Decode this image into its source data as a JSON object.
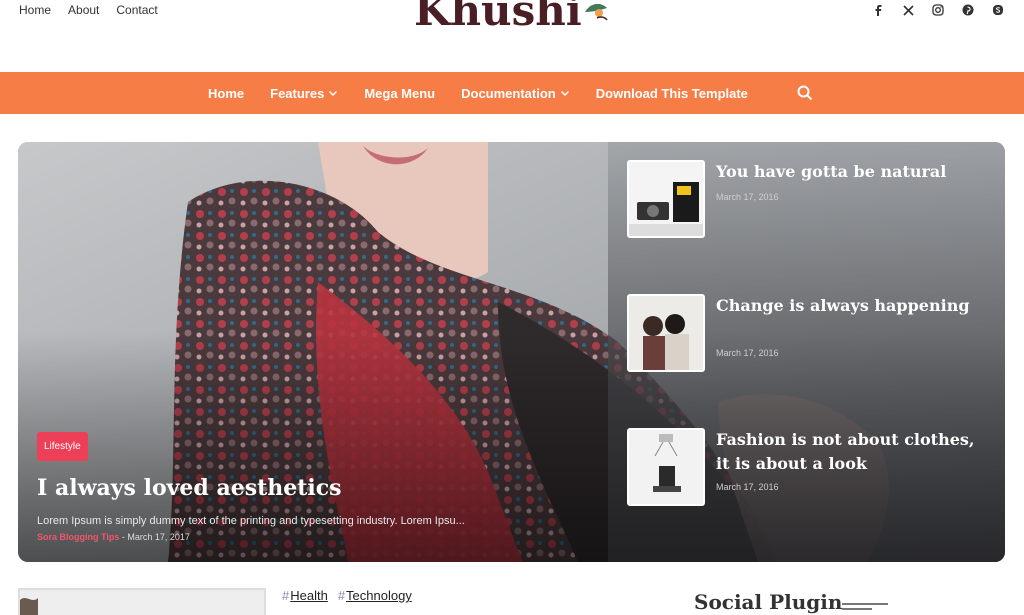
{
  "top_links": [
    "Home",
    "About",
    "Contact"
  ],
  "brand": {
    "name": "Khushi",
    "color": "#4a1f24"
  },
  "social_icons": [
    "facebook-icon",
    "x-icon",
    "instagram-icon",
    "pinterest-icon",
    "skype-icon"
  ],
  "nav": {
    "color": "#f77d47",
    "items": [
      {
        "label": "Home",
        "has_dropdown": false
      },
      {
        "label": "Features",
        "has_dropdown": true
      },
      {
        "label": "Mega Menu",
        "has_dropdown": false
      },
      {
        "label": "Documentation",
        "has_dropdown": true
      },
      {
        "label": "Download This Template",
        "has_dropdown": false
      }
    ],
    "search_icon": "search-icon"
  },
  "hero": {
    "badge": "Lifestyle",
    "title": "I always loved aesthetics",
    "excerpt": "Lorem Ipsum is simply dummy text of the printing and typesetting industry. Lorem Ipsu...",
    "author": "Sora Blogging Tips",
    "separator": "-",
    "date": "March 17, 2017"
  },
  "side_posts": [
    {
      "title": "You have gotta be natural",
      "date": "March 17, 2016"
    },
    {
      "title": "Change is always happening",
      "date": "March 17, 2016"
    },
    {
      "title": "Fashion is not about clothes, it is about a look",
      "date": "March 17, 2016"
    }
  ],
  "below": {
    "tags": [
      "Health",
      "Technology"
    ],
    "widget_title": "Social Plugin"
  }
}
